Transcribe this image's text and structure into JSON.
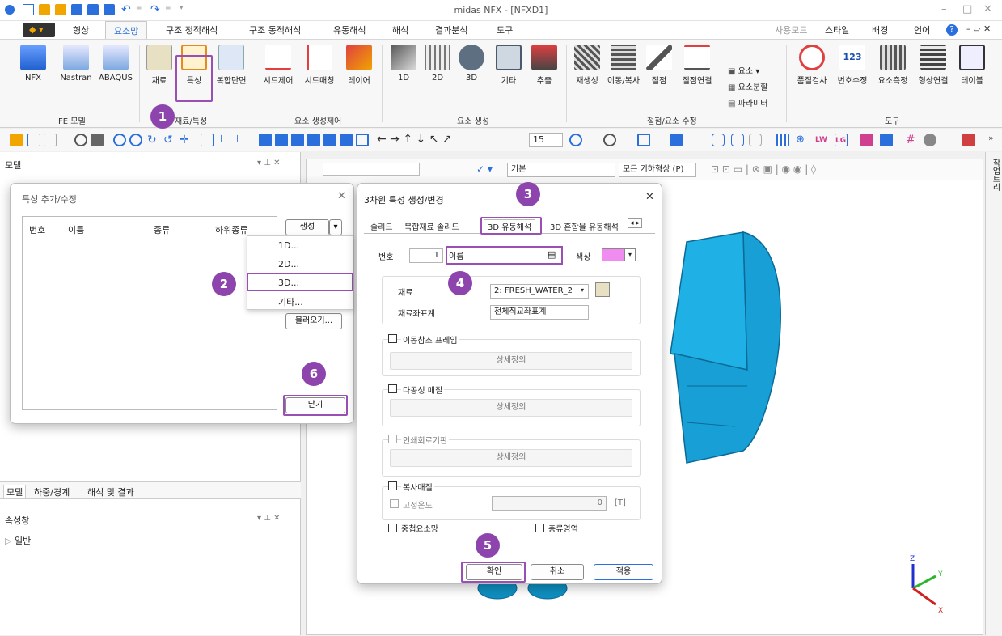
{
  "app": {
    "title": "midas NFX - [NFXD1]"
  },
  "ribbon_tabs": [
    "형상",
    "요소망",
    "구조 정적해석",
    "구조 동적해석",
    "유동해석",
    "해석",
    "결과분석",
    "도구"
  ],
  "ribbon_right": {
    "usermode": "사용모드",
    "style": "스타일",
    "bg": "배경",
    "lang": "언어"
  },
  "groups": {
    "fe": {
      "label": "FE 모델",
      "items": [
        "NFX",
        "Nastran",
        "ABAQUS"
      ]
    },
    "material": {
      "label": "재료/특성",
      "items": [
        "재료",
        "특성",
        "복합단면"
      ]
    },
    "elemctrl": {
      "label": "요소 생성제어",
      "items": [
        "시드제어",
        "시드매칭",
        "레이어"
      ]
    },
    "elemgen": {
      "label": "요소 생성",
      "items": [
        "1D",
        "2D",
        "3D",
        "기타",
        "추출"
      ]
    },
    "nodeedit": {
      "label": "절점/요소 수정",
      "items": [
        "재생성",
        "이동/복사",
        "절점",
        "절점연결"
      ],
      "small": [
        "요소",
        "요소분할",
        "파라미터"
      ]
    },
    "tools": {
      "label": "도구",
      "items": [
        "품질검사",
        "번호수정",
        "요소측정",
        "형상연결",
        "테이블"
      ]
    }
  },
  "toolbar2": {
    "zoom_value": "15"
  },
  "left_panel": {
    "model_title": "모델",
    "bottom_tabs": [
      "모델",
      "하중/경계",
      "해석 및 결과"
    ],
    "property_title": "속성창",
    "general": "일반"
  },
  "viewport_bar": {
    "filter": "기본",
    "shape": "모든 기하형상 (P)"
  },
  "right_strip": {
    "label": "작업트리"
  },
  "dialog1": {
    "title": "특성 추가/수정",
    "columns": [
      "번호",
      "이름",
      "종류",
      "하위종류"
    ],
    "create_btn": "생성",
    "menu": [
      "1D...",
      "2D...",
      "3D...",
      "기타..."
    ],
    "import_btn": "불러오기...",
    "close_btn": "닫기"
  },
  "dialog2": {
    "title": "3차원 특성 생성/변경",
    "tabs": [
      "솔리드",
      "복합재료 솔리드",
      "3D 유동해석",
      "3D 혼합물 유동해석"
    ],
    "number_label": "번호",
    "number_value": "1",
    "name_label": "이름",
    "color_label": "색상",
    "material_label": "재료",
    "material_value": "2: FRESH_WATER_2",
    "coord_label": "재료좌표계",
    "coord_value": "전체직교좌표계",
    "moving_frame": "이동참조 프레임",
    "porous": "다공성 매질",
    "pcb": "인쇄회로기판",
    "radiation": "복사매질",
    "fixed_temp": "고정온도",
    "temp_value": "0",
    "temp_unit": "[T]",
    "detail": "상세정의",
    "overlap": "중첩요소망",
    "laminar": "층류영역",
    "ok": "확인",
    "cancel": "취소",
    "apply": "적용"
  },
  "badges": [
    "1",
    "2",
    "3",
    "4",
    "5",
    "6"
  ],
  "axis": {
    "x": "X",
    "y": "Y",
    "z": "Z"
  },
  "colors": {
    "accent": "#9a4fb5",
    "badge": "#8e44ad",
    "model": "#1fb0e6",
    "swatch": "#f08cf0"
  }
}
